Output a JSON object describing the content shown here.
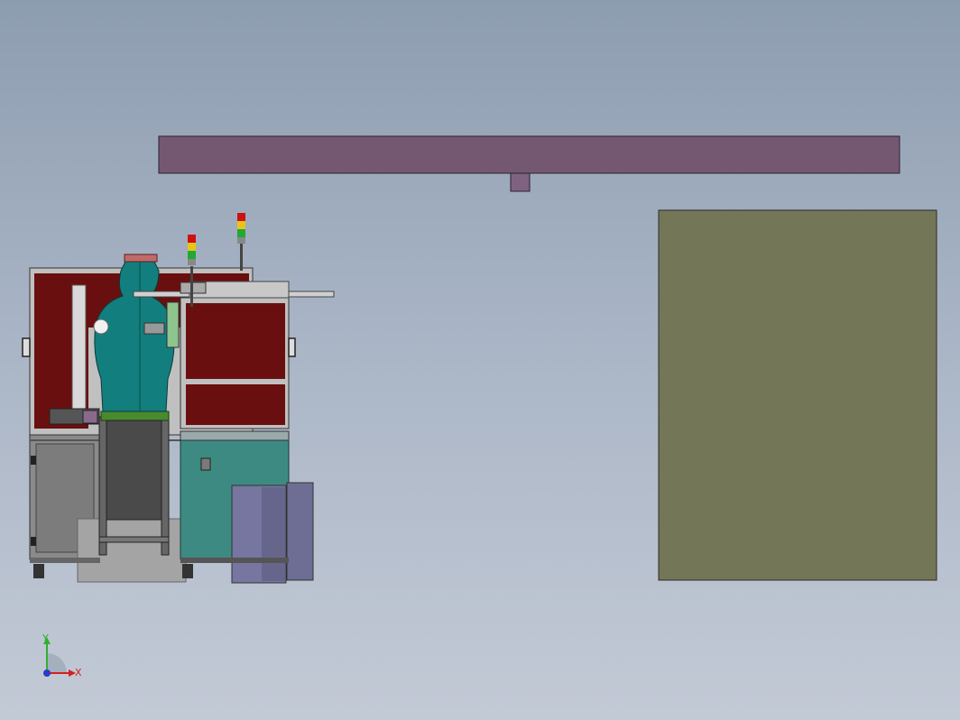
{
  "viewport": {
    "background_top": "#8d9db0",
    "background_bottom": "#c3cad6"
  },
  "colors": {
    "beam": "#745872",
    "panel": "#747658",
    "frame_red": "#6a0f0f",
    "mannequin": "#137e7e",
    "cabinet_teal": "#3d8a82",
    "bin_purple": "#6e6e94"
  },
  "axis_triad": {
    "x_label": "X",
    "y_label": "Y",
    "x_color": "#d42020",
    "y_color": "#30b030",
    "z_color": "#2a3ccc"
  },
  "signal_tower": {
    "lights": [
      "#cc1111",
      "#e8c417",
      "#22a834"
    ]
  },
  "icons": [
    "axis-triad-icon"
  ]
}
